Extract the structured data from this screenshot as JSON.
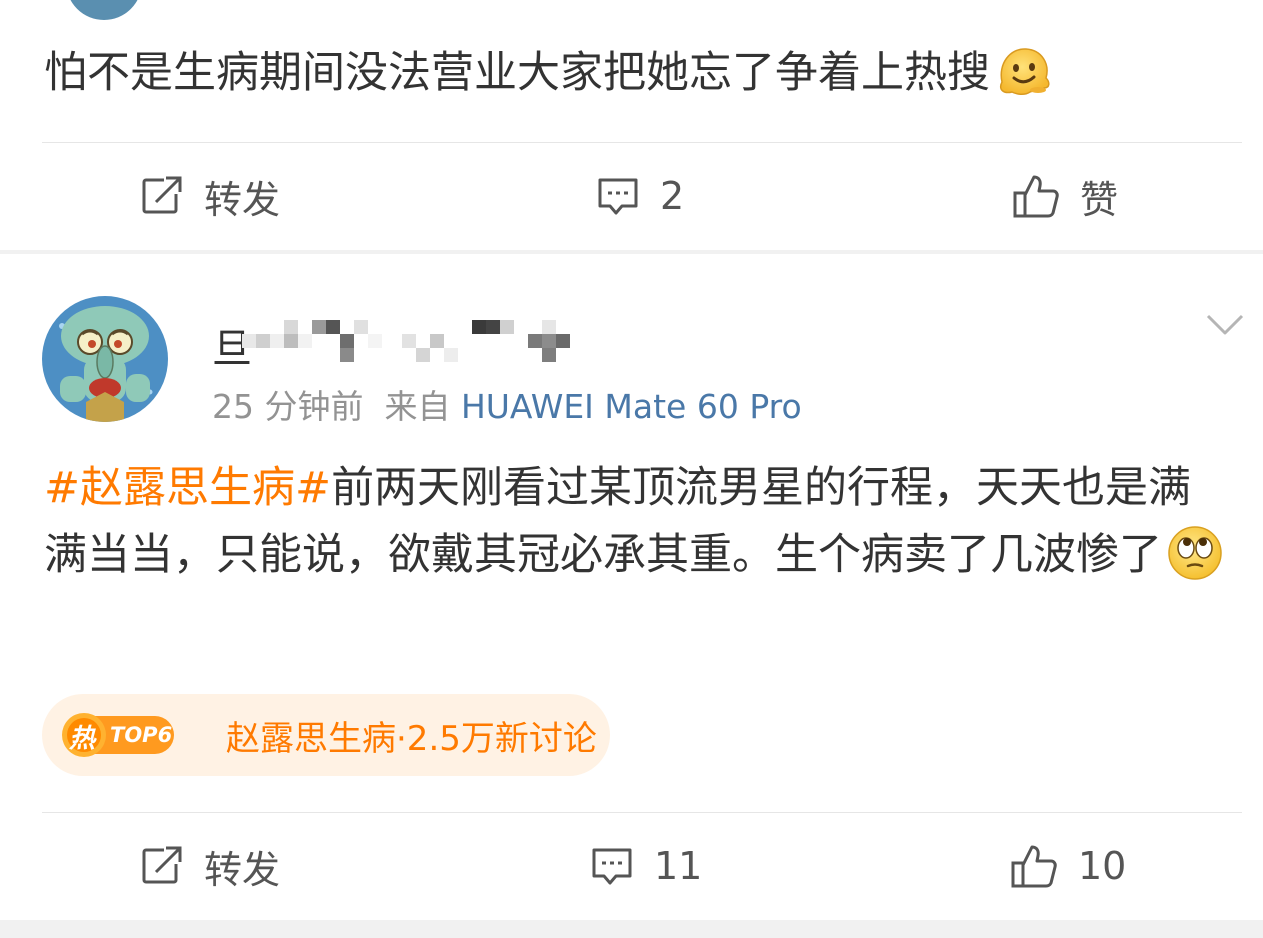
{
  "post1": {
    "text": "怕不是生病期间没法营业大家把她忘了争着上热搜",
    "emoji": "melting-face-icon",
    "actions": {
      "share_label": "转发",
      "comment_count": "2",
      "like_label": "赞"
    }
  },
  "post2": {
    "username_first_char": "旦",
    "meta_time": "25 分钟前",
    "meta_from": "来自",
    "meta_device": "HUAWEI Mate 60 Pro",
    "hashtag": "#赵露思生病#",
    "text": "前两天刚看过某顶流男星的行程，天天也是满满当当，只能说，欲戴其冠必承其重。生个病卖了几波惨了",
    "emoji": "eye-roll-face-icon",
    "topic": {
      "badge_char": "热",
      "badge_rank": "TOP6",
      "text": "赵露思生病·2.5万新讨论"
    },
    "actions": {
      "share_label": "转发",
      "comment_count": "11",
      "like_count": "10"
    }
  },
  "colors": {
    "accent": "#ff7a00",
    "device_link": "#4a78a8",
    "topic_bg": "#fff2e4",
    "text": "#333333",
    "meta": "#939393"
  }
}
